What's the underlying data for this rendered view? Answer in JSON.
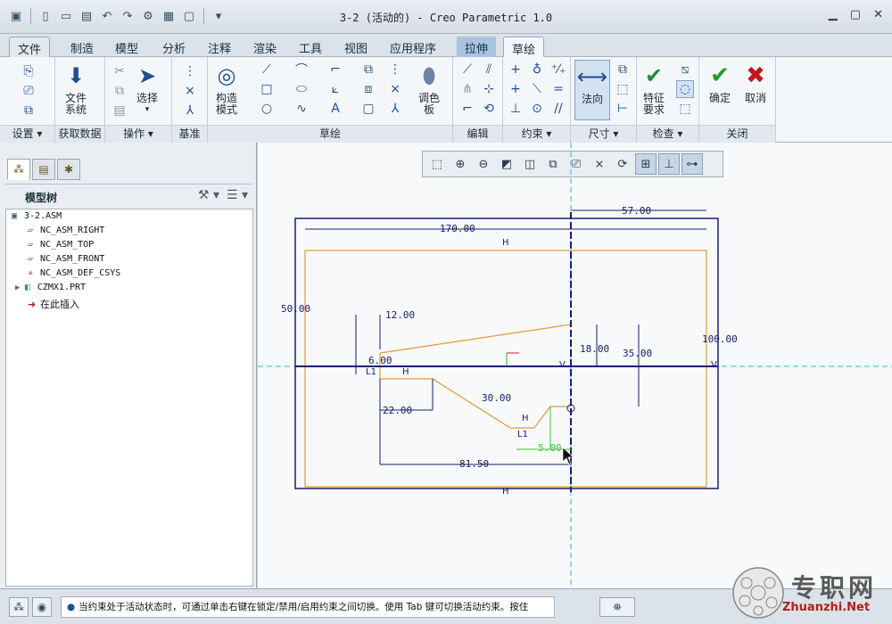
{
  "window": {
    "title": "3-2 (活动的) - Creo Parametric 1.0"
  },
  "tabs": [
    "文件",
    "制造",
    "模型",
    "分析",
    "注释",
    "渲染",
    "工具",
    "视图",
    "应用程序",
    "拉伸",
    "草绘"
  ],
  "ribbon": {
    "groups": [
      "设置",
      "获取数据",
      "操作",
      "基准",
      "草绘",
      "编辑",
      "约束",
      "尺寸",
      "检查",
      "关闭"
    ],
    "buttons": {
      "file_system": "文件系统",
      "select": "选择",
      "construction": "构造模式",
      "palette": "调色板",
      "normal": "法向",
      "feature_req": "特征要求",
      "ok": "确定",
      "cancel": "取消"
    }
  },
  "model_tree": {
    "title": "模型树",
    "items": [
      "3-2.ASM",
      "NC_ASM_RIGHT",
      "NC_ASM_TOP",
      "NC_ASM_FRONT",
      "NC_ASM_DEF_CSYS",
      "CZMX1.PRT",
      "在此插入"
    ]
  },
  "sketch": {
    "dims": [
      "57.00",
      "170.00",
      "50.00",
      "12.00",
      "6.00",
      "18.00",
      "35.00",
      "100.00",
      "30.00",
      "22.00",
      "81.50",
      "5.00"
    ],
    "constraints": [
      "H",
      "V",
      "L1"
    ]
  },
  "status": {
    "message": "当约束处于活动状态时，可通过单击右键在锁定/禁用/启用约束之间切换。使用 Tab 键可切换活动约束。按住"
  },
  "watermark": {
    "brand": "专职网",
    "url": "Zhuanzhi.Net"
  }
}
